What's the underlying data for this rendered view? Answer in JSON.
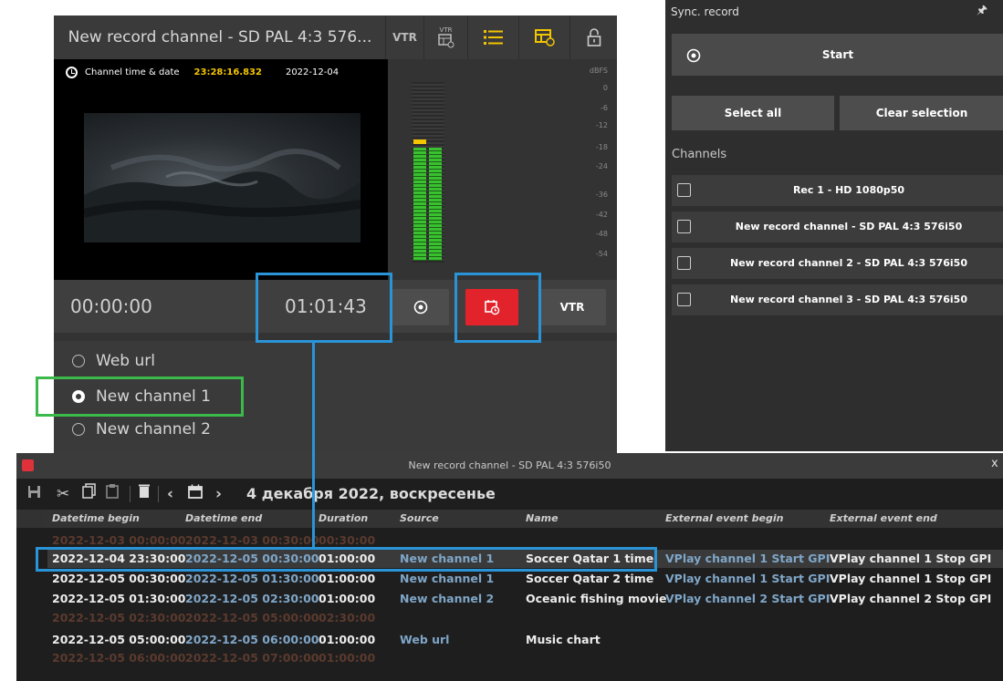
{
  "channel_panel": {
    "title": "New record channel - SD PAL 4:3 576...",
    "vtr_label": "VTR",
    "vtr_small": "VTR",
    "time_label": "Channel time & date",
    "time_value": "23:28:16.832",
    "date_value": "2022-12-04",
    "dbfs_label": "dBFS",
    "dbfs_ticks": [
      "0",
      "-6",
      "-12",
      "-18",
      "-24",
      "-36",
      "-42",
      "-48",
      "-54"
    ],
    "timecode_left": "00:00:00",
    "timecode_right": "01:01:43",
    "vtr_button": "VTR",
    "accent_red": "#e3232c",
    "accent_yellow": "#f3c400"
  },
  "sources": {
    "items": [
      {
        "label": "Web url",
        "selected": false
      },
      {
        "label": "New channel 1",
        "selected": true
      },
      {
        "label": "New channel 2",
        "selected": false
      }
    ]
  },
  "sync_record": {
    "title": "Sync. record",
    "start_label": "Start",
    "select_all": "Select all",
    "clear_selection": "Clear selection",
    "channels_label": "Channels",
    "channels": [
      "Rec 1 - HD 1080p50",
      "New record channel - SD PAL 4:3 576i50",
      "New record channel 2 - SD PAL 4:3 576i50",
      "New record channel 3 - SD PAL 4:3 576i50"
    ]
  },
  "scheduler": {
    "window_title": "New record channel - SD PAL 4:3 576i50",
    "close": "x",
    "date_heading": "4 декабря 2022, воскресенье",
    "columns": [
      "Datetime begin",
      "Datetime end",
      "Duration",
      "Source",
      "Name",
      "External event begin",
      "External event end"
    ],
    "rows": [
      {
        "begin": "2022-12-03 00:00:00",
        "end": "2022-12-03 00:30:00",
        "duration": "00:30:00",
        "source": "",
        "name": "",
        "ext_begin": "",
        "ext_end": "",
        "past": true
      },
      {
        "begin": "2022-12-04 23:30:00",
        "end": "2022-12-05 00:30:00",
        "duration": "01:00:00",
        "source": "New channel 1",
        "name": "Soccer Qatar 1 time",
        "ext_begin": "VPlay channel 1 Start GPI",
        "ext_end": "VPlay channel 1 Stop GPI",
        "past": false,
        "selected": true
      },
      {
        "begin": "2022-12-05 00:30:00",
        "end": "2022-12-05 01:30:00",
        "duration": "01:00:00",
        "source": "New channel 1",
        "name": "Soccer Qatar 2 time",
        "ext_begin": "VPlay channel 1 Start GPI",
        "ext_end": "VPlay channel 1 Stop GPI",
        "past": false
      },
      {
        "begin": "2022-12-05 01:30:00",
        "end": "2022-12-05 02:30:00",
        "duration": "01:00:00",
        "source": "New channel 2",
        "name": "Oceanic fishing movie",
        "ext_begin": "VPlay channel 2 Start GPI",
        "ext_end": "VPlay channel 2 Stop GPI",
        "past": false
      },
      {
        "begin": "2022-12-05 02:30:00",
        "end": "2022-12-05 05:00:00",
        "duration": "02:30:00",
        "source": "",
        "name": "",
        "ext_begin": "",
        "ext_end": "",
        "past": true
      },
      {
        "begin": "2022-12-05 05:00:00",
        "end": "2022-12-05 06:00:00",
        "duration": "01:00:00",
        "source": "Web url",
        "name": "Music chart",
        "ext_begin": "",
        "ext_end": "",
        "past": false
      },
      {
        "begin": "2022-12-05 06:00:00",
        "end": "2022-12-05 07:00:00",
        "duration": "01:00:00",
        "source": "",
        "name": "",
        "ext_begin": "",
        "ext_end": "",
        "past": true
      }
    ]
  }
}
